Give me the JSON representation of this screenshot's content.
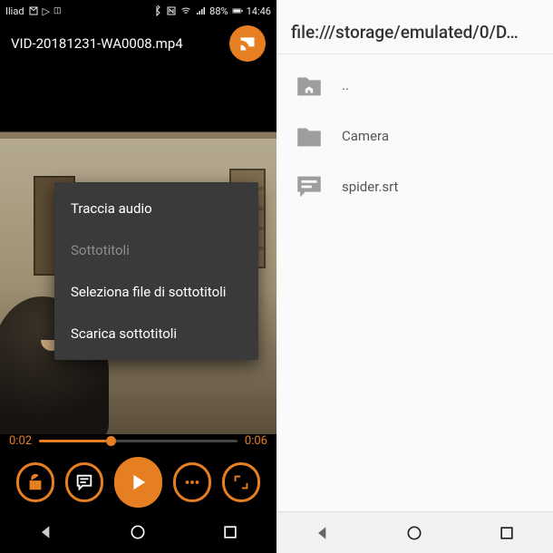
{
  "colors": {
    "accent": "#e67e22"
  },
  "status": {
    "carrier": "Iliad",
    "battery_pct": "88%",
    "time": "14:46"
  },
  "player": {
    "title": "VID-20181231-WA0008.mp4",
    "time_current": "0:02",
    "time_total": "0:06"
  },
  "popup": {
    "items": [
      {
        "label": "Traccia audio",
        "enabled": true
      },
      {
        "label": "Sottotitoli",
        "enabled": false
      },
      {
        "label": "Seleziona file di sottotitoli",
        "enabled": true
      },
      {
        "label": "Scarica sottotitoli",
        "enabled": true
      }
    ]
  },
  "browser": {
    "path": "file:///storage/emulated/0/D…",
    "entries": [
      {
        "kind": "home",
        "label": ".."
      },
      {
        "kind": "folder",
        "label": "Camera"
      },
      {
        "kind": "subs",
        "label": "spider.srt"
      }
    ]
  }
}
